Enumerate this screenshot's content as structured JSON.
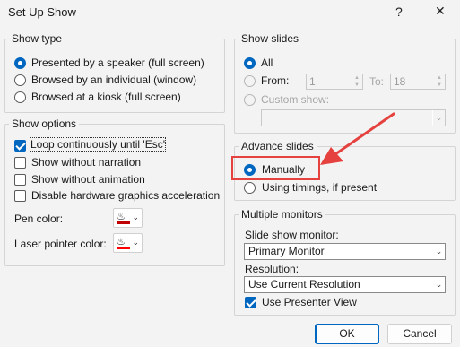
{
  "title": "Set Up Show",
  "titlebar": {
    "help": "?",
    "close": "✕"
  },
  "show_type": {
    "legend": "Show type",
    "options": [
      "Presented by a speaker (full screen)",
      "Browsed by an individual (window)",
      "Browsed at a kiosk (full screen)"
    ],
    "selected_index": 0
  },
  "show_options": {
    "legend": "Show options",
    "checkboxes": [
      {
        "label": "Loop continuously until 'Esc'",
        "checked": true
      },
      {
        "label": "Show without narration",
        "checked": false
      },
      {
        "label": "Show without animation",
        "checked": false
      },
      {
        "label": "Disable hardware graphics acceleration",
        "checked": false
      }
    ],
    "pen_color_label": "Pen color:",
    "laser_color_label": "Laser pointer color:",
    "pen_color": "#c00000",
    "laser_color": "#ff0000"
  },
  "show_slides": {
    "legend": "Show slides",
    "all_label": "All",
    "from_label": "From:",
    "from_value": "1",
    "to_label": "To:",
    "to_value": "18",
    "custom_label": "Custom show:",
    "custom_value": ""
  },
  "advance_slides": {
    "legend": "Advance slides",
    "manually_label": "Manually",
    "timings_label": "Using timings, if present",
    "highlight_color": "#e5413e"
  },
  "monitors": {
    "legend": "Multiple monitors",
    "slide_show_monitor_label": "Slide show monitor:",
    "slide_show_monitor_value": "Primary Monitor",
    "resolution_label": "Resolution:",
    "resolution_value": "Use Current Resolution",
    "presenter_view_label": "Use Presenter View",
    "presenter_view_checked": true
  },
  "buttons": {
    "ok": "OK",
    "cancel": "Cancel"
  },
  "accent_color": "#0067c0"
}
